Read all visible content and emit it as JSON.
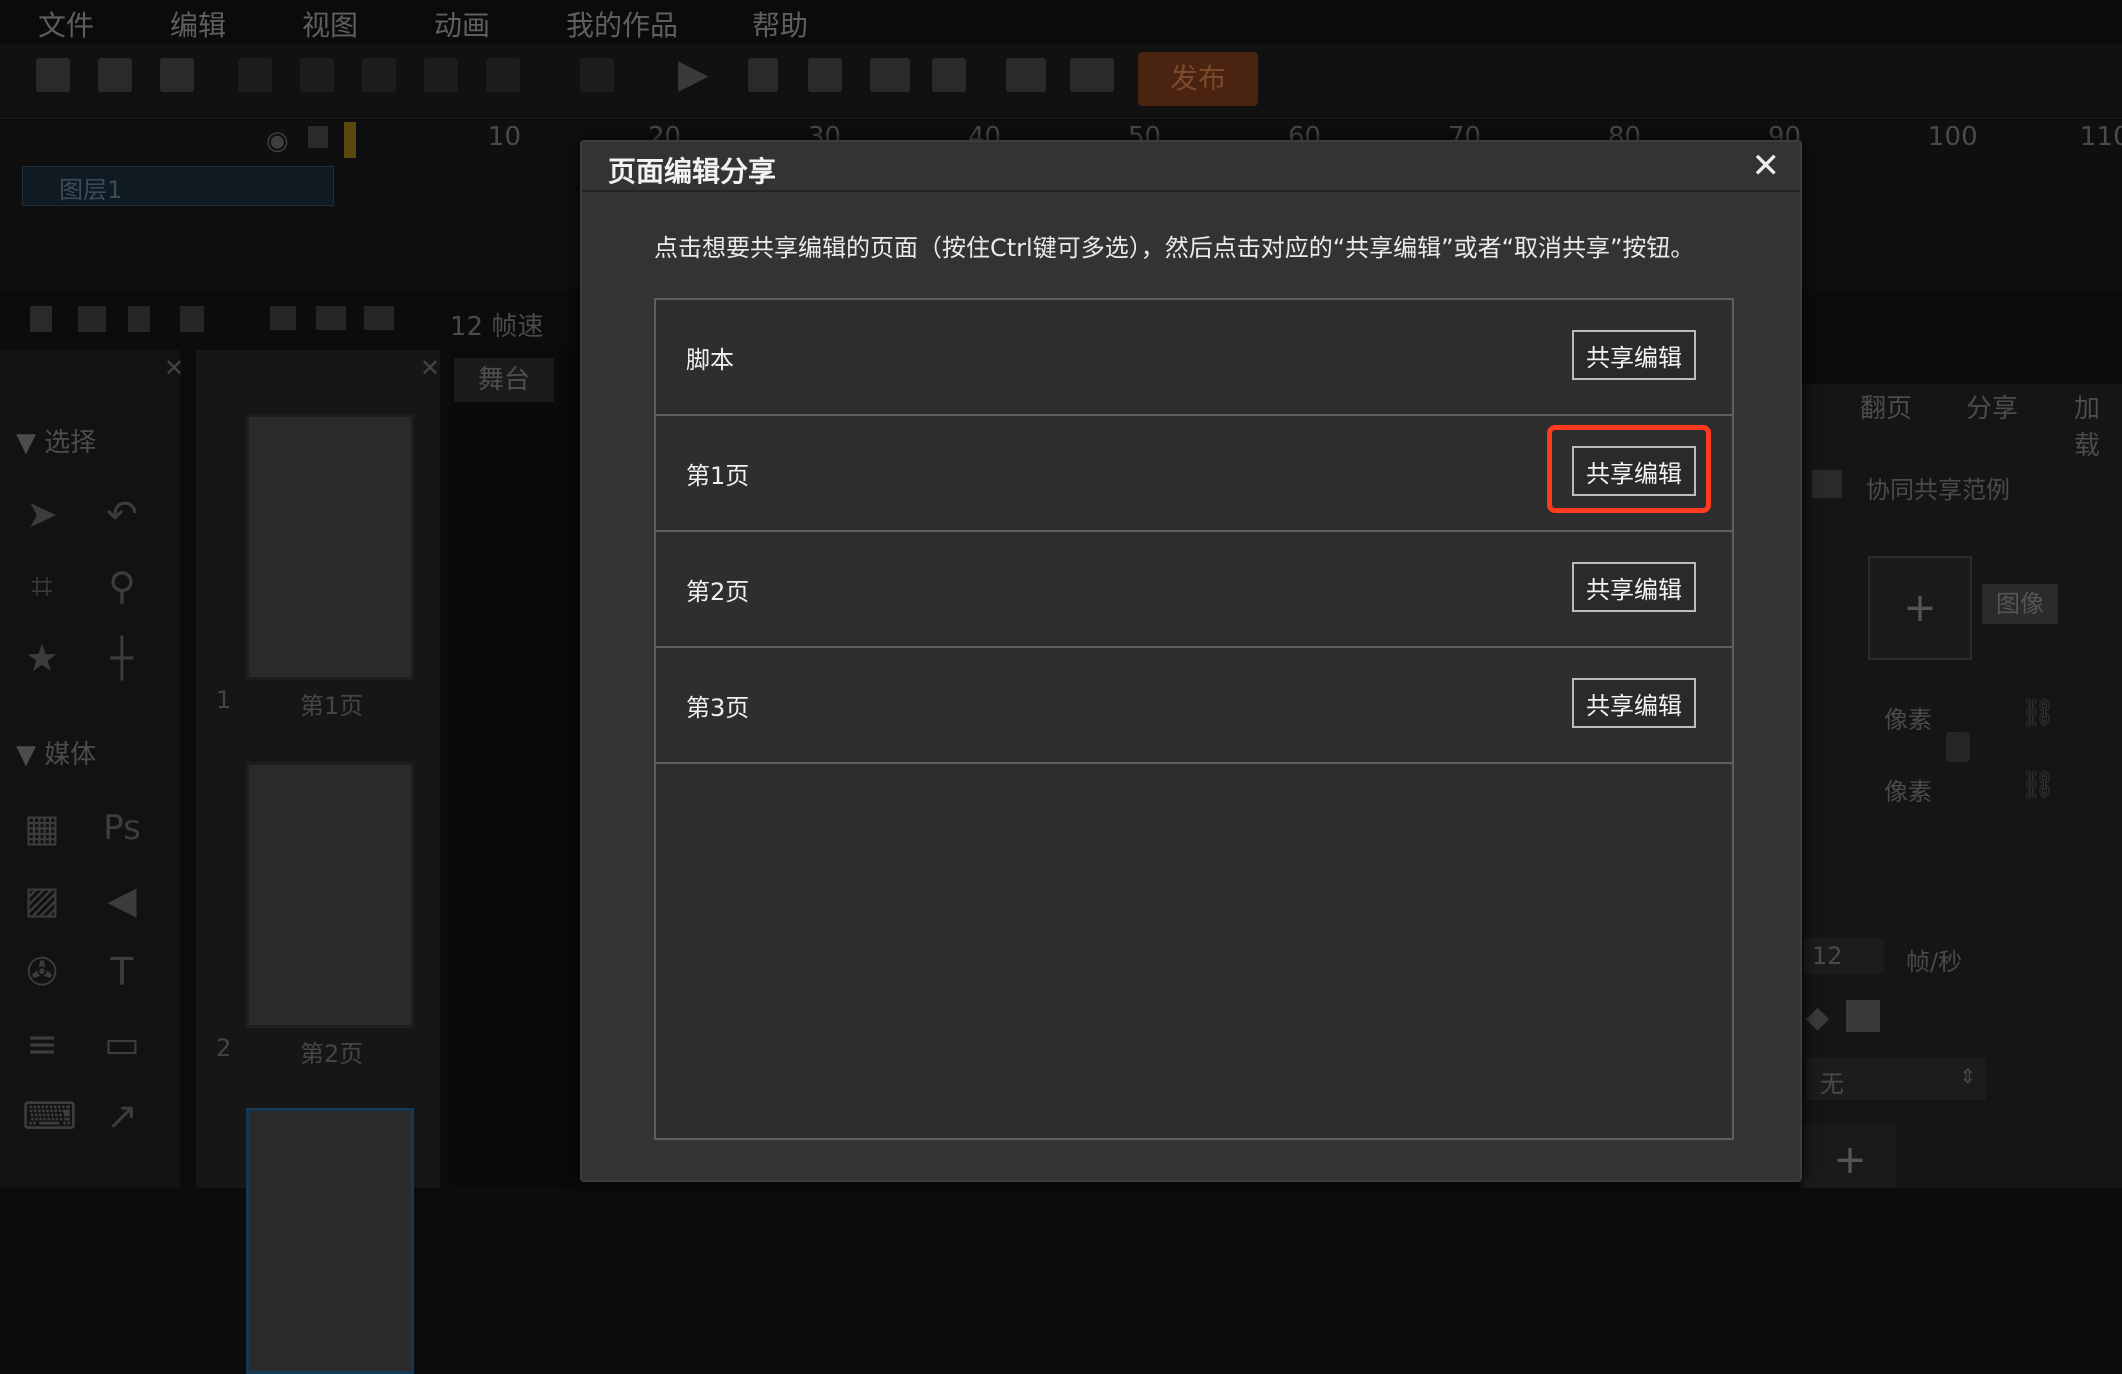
{
  "menu": [
    "文件",
    "编辑",
    "视图",
    "动画",
    "我的作品",
    "帮助"
  ],
  "toolbar": {
    "publish_label": "发布"
  },
  "timeline": {
    "ruler": [
      "10",
      "20",
      "30",
      "40",
      "50",
      "60",
      "70",
      "80",
      "90",
      "100",
      "110"
    ],
    "layer_name": "图层1",
    "fps_label": "12 帧速"
  },
  "left_panel": {
    "select_header": "选择",
    "media_header": "媒体"
  },
  "pages_panel": {
    "pages": [
      {
        "num": "1",
        "label": "第1页"
      },
      {
        "num": "2",
        "label": "第2页"
      }
    ]
  },
  "stage": {
    "tab_label": "舞台"
  },
  "right_panel": {
    "tabs": [
      "翻页",
      "分享",
      "加载"
    ],
    "doc_name": "协同共享范例",
    "image_label": "图像",
    "pixel_label_1": "像素",
    "pixel_label_2": "像素",
    "fps_value": "12",
    "fps_unit": "帧/秒",
    "select_value": "无"
  },
  "dialog": {
    "title": "页面编辑分享",
    "close_symbol": "✕",
    "instruction": "点击想要共享编辑的页面（按住Ctrl键可多选），然后点击对应的“共享编辑”或者“取消共享”按钮。",
    "rows": [
      {
        "label": "脚本",
        "button": "共享编辑"
      },
      {
        "label": "第1页",
        "button": "共享编辑"
      },
      {
        "label": "第2页",
        "button": "共享编辑"
      },
      {
        "label": "第3页",
        "button": "共享编辑"
      }
    ]
  },
  "colors": {
    "highlight": "#ff3b1f",
    "dialog_bg": "#333333"
  }
}
